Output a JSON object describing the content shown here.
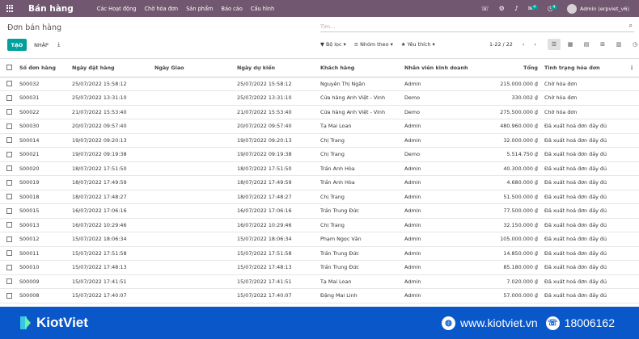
{
  "app": {
    "name": "Bán hàng",
    "menu": [
      "Các Hoạt động",
      "Chờ hóa đơn",
      "Sản phẩm",
      "Báo cáo",
      "Cấu hình"
    ],
    "badges": {
      "messages": "4",
      "activities": "4"
    },
    "user": "Admin (erpviet_v6)",
    "accent": "#71576f",
    "primary": "#00a09d"
  },
  "control": {
    "title": "Đơn bán hàng",
    "search_placeholder": "Tìm...",
    "create_label": "TẠO",
    "import_label": "NHẬP",
    "filters": [
      "Bộ lọc",
      "Nhóm theo",
      "Yêu thích"
    ],
    "pager": "1-22 / 22"
  },
  "table": {
    "columns": [
      "Số đơn hàng",
      "Ngày đặt hàng",
      "Ngày Giao",
      "Ngày dự kiến",
      "Khách hàng",
      "Nhân viên kinh doanh",
      "Tổng",
      "Tình trạng hóa đơn"
    ],
    "rows": [
      [
        "S00032",
        "25/07/2022 15:58:12",
        "",
        "25/07/2022 15:58:12",
        "Nguyễn Thị Ngân",
        "Admin",
        "215.000.000 ₫",
        "Chờ hóa đơn"
      ],
      [
        "S00031",
        "25/07/2022 13:31:10",
        "",
        "25/07/2022 13:31:10",
        "Cửa hàng Anh Việt - Vinh",
        "Demo",
        "330.002 ₫",
        "Chờ hóa đơn"
      ],
      [
        "S00022",
        "21/07/2022 15:53:40",
        "",
        "21/07/2022 15:53:40",
        "Cửa hàng Anh Việt - Vinh",
        "Demo",
        "275.500.000 ₫",
        "Chờ hóa đơn"
      ],
      [
        "S00030",
        "20/07/2022 09:57:40",
        "",
        "20/07/2022 09:57:40",
        "Tạ Mai Loan",
        "Admin",
        "480.960.000 ₫",
        "Đã xuất hoá đơn đầy đủ"
      ],
      [
        "S00014",
        "19/07/2022 09:20:13",
        "",
        "19/07/2022 09:20:13",
        "Chị Trang",
        "Admin",
        "32.000.000 ₫",
        "Đã xuất hoá đơn đầy đủ"
      ],
      [
        "S00021",
        "19/07/2022 09:19:38",
        "",
        "19/07/2022 09:19:38",
        "Chị Trang",
        "Demo",
        "5.514.750 ₫",
        "Đã xuất hoá đơn đầy đủ"
      ],
      [
        "S00020",
        "18/07/2022 17:51:50",
        "",
        "18/07/2022 17:51:50",
        "Trần Anh Hòa",
        "Admin",
        "40.300.000 ₫",
        "Đã xuất hoá đơn đầy đủ"
      ],
      [
        "S00019",
        "18/07/2022 17:49:59",
        "",
        "18/07/2022 17:49:59",
        "Trần Anh Hòa",
        "Admin",
        "4.680.000 ₫",
        "Đã xuất hoá đơn đầy đủ"
      ],
      [
        "S00018",
        "18/07/2022 17:48:27",
        "",
        "18/07/2022 17:48:27",
        "Chị Trang",
        "Admin",
        "51.500.000 ₫",
        "Đã xuất hoá đơn đầy đủ"
      ],
      [
        "S00015",
        "16/07/2022 17:06:16",
        "",
        "16/07/2022 17:06:16",
        "Trần Trung Đức",
        "Admin",
        "77.500.000 ₫",
        "Đã xuất hoá đơn đầy đủ"
      ],
      [
        "S00013",
        "16/07/2022 10:29:46",
        "",
        "16/07/2022 10:29:46",
        "Chị Trang",
        "Admin",
        "32.150.000 ₫",
        "Đã xuất hoá đơn đầy đủ"
      ],
      [
        "S00012",
        "15/07/2022 18:06:34",
        "",
        "15/07/2022 18:06:34",
        "Phạm Ngọc Văn",
        "Admin",
        "105.000.000 ₫",
        "Đã xuất hoá đơn đầy đủ"
      ],
      [
        "S00011",
        "15/07/2022 17:51:58",
        "",
        "15/07/2022 17:51:58",
        "Trần Trung Đức",
        "Admin",
        "14.850.000 ₫",
        "Đã xuất hoá đơn đầy đủ"
      ],
      [
        "S00010",
        "15/07/2022 17:48:13",
        "",
        "15/07/2022 17:48:13",
        "Trần Trung Đức",
        "Admin",
        "85.180.000 ₫",
        "Đã xuất hoá đơn đầy đủ"
      ],
      [
        "S00009",
        "15/07/2022 17:41:51",
        "",
        "15/07/2022 17:41:51",
        "Tạ Mai Loan",
        "Admin",
        "7.020.000 ₫",
        "Đã xuất hoá đơn đầy đủ"
      ],
      [
        "S00008",
        "15/07/2022 17:40:07",
        "",
        "15/07/2022 17:40:07",
        "Đặng Mai Linh",
        "Admin",
        "57.000.000 ₫",
        "Đã xuất hoá đơn đầy đủ"
      ]
    ]
  },
  "banner": {
    "brand": "KiotViet",
    "website": "www.kiotviet.vn",
    "phone": "18006162",
    "color": "#0a57c9"
  }
}
